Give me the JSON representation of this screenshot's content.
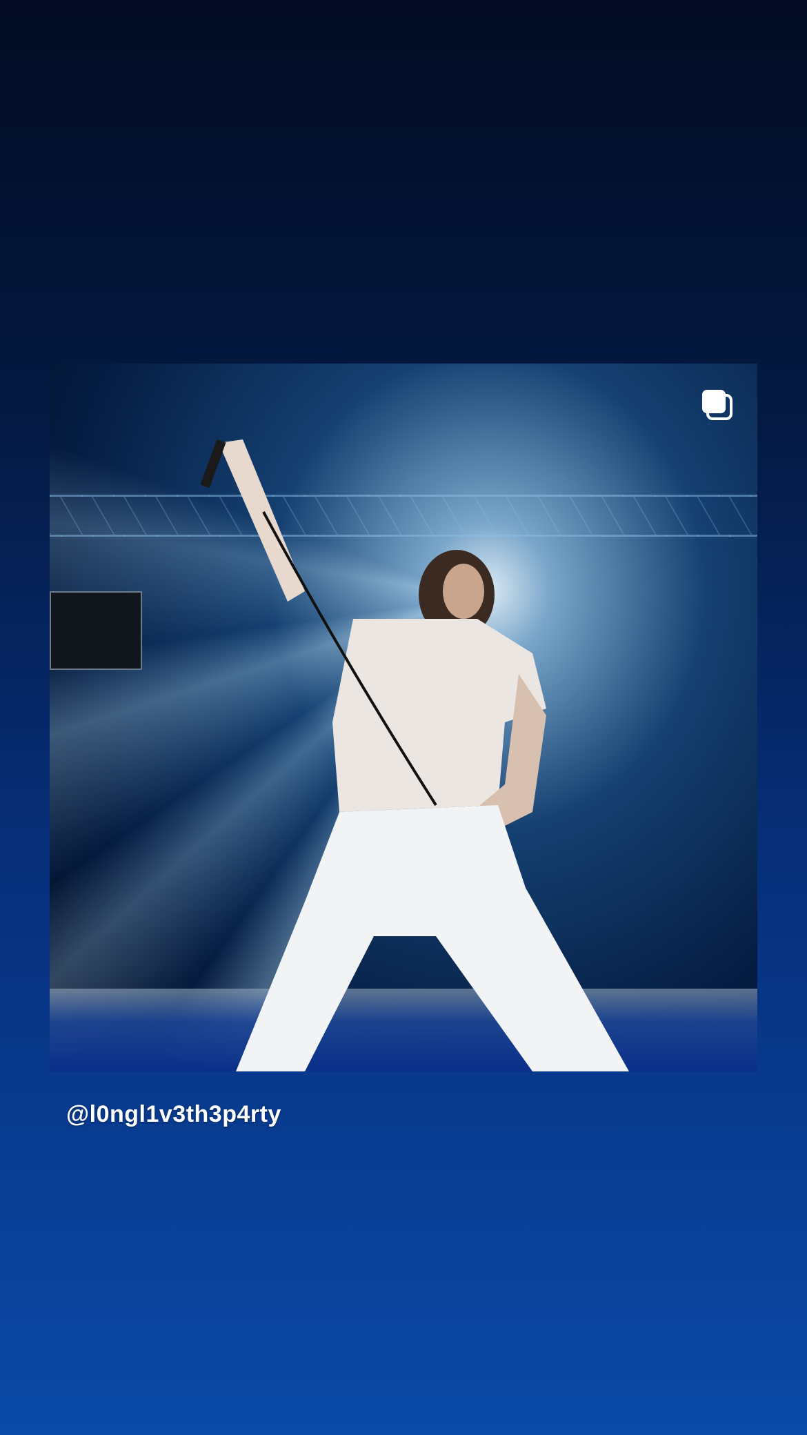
{
  "post": {
    "username": "@l0ngl1v3th3p4rty",
    "media_icon": "multiple-photos-icon",
    "photo_subject": "concert-performer-photo"
  }
}
